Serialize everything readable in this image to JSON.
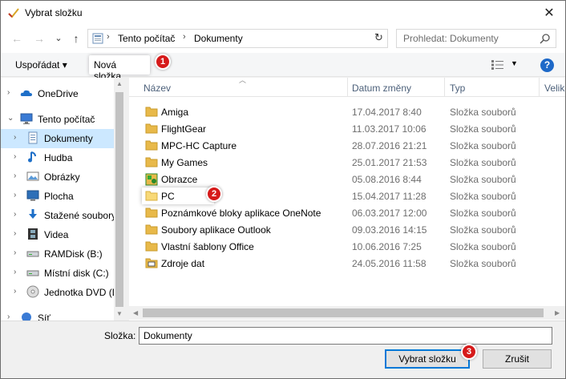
{
  "window": {
    "title": "Vybrat složku",
    "close_glyph": "✕"
  },
  "nav": {
    "back": "←",
    "forward": "→",
    "recent": "⌄",
    "up": "↑",
    "breadcrumb": [
      "Tento počítač",
      "Dokumenty"
    ],
    "breadcrumb_sep": "›",
    "address_dropdown": "⌄",
    "refresh": "↻",
    "search_placeholder": "Prohledat: Dokumenty"
  },
  "toolbar": {
    "organize": "Uspořádat ▾",
    "new_folder": "Nová složka",
    "help": "?"
  },
  "badges": [
    "1",
    "2",
    "3"
  ],
  "sidebar": {
    "items": [
      {
        "label": "OneDrive",
        "icon": "cloud-icon",
        "chevron": "›"
      },
      {
        "label": "Tento počítač",
        "icon": "computer-icon",
        "chevron": "⌄"
      },
      {
        "label": "Dokumenty",
        "icon": "documents-icon",
        "chevron": "›",
        "selected": true
      },
      {
        "label": "Hudba",
        "icon": "music-icon",
        "chevron": "›"
      },
      {
        "label": "Obrázky",
        "icon": "pictures-icon",
        "chevron": "›"
      },
      {
        "label": "Plocha",
        "icon": "desktop-icon",
        "chevron": "›"
      },
      {
        "label": "Stažené soubory",
        "icon": "download-icon",
        "chevron": "›"
      },
      {
        "label": "Videa",
        "icon": "video-icon",
        "chevron": "›"
      },
      {
        "label": "RAMDisk (B:)",
        "icon": "drive-icon",
        "chevron": "›"
      },
      {
        "label": "Místní disk (C:)",
        "icon": "drive-icon",
        "chevron": "›"
      },
      {
        "label": "Jednotka DVD (D",
        "icon": "dvd-icon",
        "chevron": "›"
      },
      {
        "label": "Síť",
        "icon": "network-icon",
        "chevron": "›"
      }
    ]
  },
  "columns": {
    "name": "Název",
    "date": "Datum změny",
    "type": "Typ",
    "size": "Velikost"
  },
  "files": [
    {
      "name": "Amiga",
      "date": "17.04.2017 8:40",
      "type": "Složka souborů",
      "icon": "folder-icon"
    },
    {
      "name": "FlightGear",
      "date": "11.03.2017 10:06",
      "type": "Složka souborů",
      "icon": "folder-icon"
    },
    {
      "name": "MPC-HC Capture",
      "date": "28.07.2016 21:21",
      "type": "Složka souborů",
      "icon": "folder-icon"
    },
    {
      "name": "My Games",
      "date": "25.01.2017 21:53",
      "type": "Složka souborů",
      "icon": "folder-icon"
    },
    {
      "name": "Obrazce",
      "date": "05.08.2016 8:44",
      "type": "Složka souborů",
      "icon": "shapes-folder-icon"
    },
    {
      "name": "PC",
      "date": "15.04.2017 11:28",
      "type": "Složka souborů",
      "icon": "folder-icon",
      "highlighted": true
    },
    {
      "name": "Poznámkové bloky aplikace OneNote",
      "date": "06.03.2017 12:00",
      "type": "Složka souborů",
      "icon": "folder-icon"
    },
    {
      "name": "Soubory aplikace Outlook",
      "date": "09.03.2016 14:15",
      "type": "Složka souborů",
      "icon": "folder-icon"
    },
    {
      "name": "Vlastní šablony Office",
      "date": "10.06.2016 7:25",
      "type": "Složka souborů",
      "icon": "folder-icon"
    },
    {
      "name": "Zdroje dat",
      "date": "24.05.2016 11:58",
      "type": "Složka souborů",
      "icon": "datasource-folder-icon"
    }
  ],
  "bottom": {
    "folder_label": "Složka:",
    "folder_value": "Dokumenty",
    "select_button": "Vybrat složku",
    "cancel_button": "Zrušit"
  },
  "colors": {
    "accent": "#0078d7",
    "selection": "#cce8ff",
    "badge": "#d61a1a",
    "folder": "#e8b94a"
  }
}
